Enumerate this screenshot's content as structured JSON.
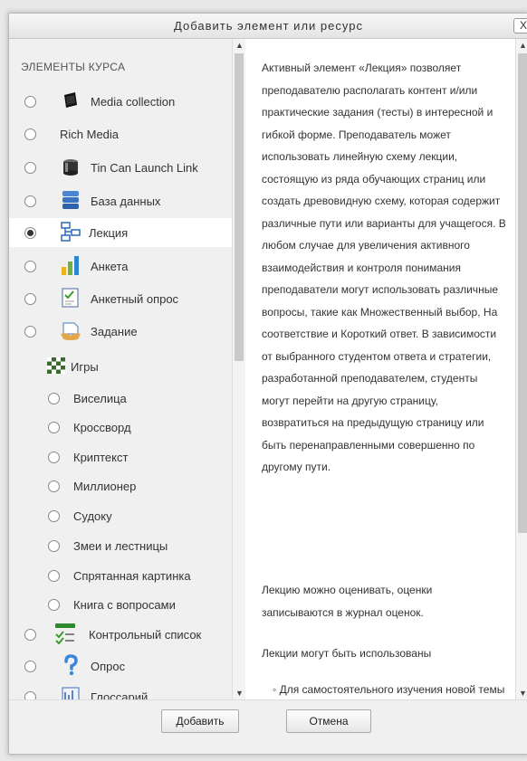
{
  "dialog": {
    "title": "Добавить элемент или ресурс",
    "close_label": "X"
  },
  "left": {
    "section_heading": "ЭЛЕМЕНТЫ КУРСА",
    "items": [
      {
        "label": "Media collection",
        "icon": "media-collection-icon",
        "checked": false
      },
      {
        "label": "Rich Media",
        "icon": "",
        "checked": false
      },
      {
        "label": "Tin Can Launch Link",
        "icon": "tincan-icon",
        "checked": false
      },
      {
        "label": "База данных",
        "icon": "database-icon",
        "checked": false
      },
      {
        "label": "Лекция",
        "icon": "lesson-icon",
        "checked": true
      },
      {
        "label": "Анкета",
        "icon": "questionnaire-icon",
        "checked": false
      },
      {
        "label": "Анкетный опрос",
        "icon": "survey-icon",
        "checked": false
      },
      {
        "label": "Задание",
        "icon": "assignment-icon",
        "checked": false
      }
    ],
    "games_group": {
      "label": "Игры",
      "icon": "games-icon",
      "items": [
        "Виселица",
        "Кроссворд",
        "Криптекст",
        "Миллионер",
        "Судоку",
        "Змеи и лестницы",
        "Спрятанная картинка",
        "Книга с вопросами"
      ]
    },
    "items_after": [
      {
        "label": "Контрольный список",
        "icon": "checklist-icon"
      },
      {
        "label": "Опрос",
        "icon": "choice-icon"
      },
      {
        "label": "Глоссарий",
        "icon": "glossary-icon"
      }
    ]
  },
  "description": {
    "paragraphs": [
      "Активный элемент «Лекция» позволяет преподавателю располагать контент и/или практические задания (тесты) в интересной и гибкой форме. Преподаватель может использовать линейную схему лекции, состоящую из ряда обучающих страниц или создать древовидную схему, которая содержит различные пути или варианты для учащегося. В любом случае для увеличения активного взаимодействия и контроля понимания преподаватели могут использовать различные вопросы, такие как Множественный выбор, На соответствие и Короткий ответ. В зависимости от выбранного студентом ответа и стратегии, разработанной преподавателем, студенты могут перейти на другую страницу, возвратиться на предыдущую страницу или быть перенаправленными совершенно по другому пути.",
      "Лекцию можно оценивать, оценки записываются в журнал оценок.",
      "Лекции могут быть использованы"
    ],
    "bullets": [
      "Для самостоятельного изучения новой темы"
    ]
  },
  "footer": {
    "add_label": "Добавить",
    "cancel_label": "Отмена"
  },
  "colors": {
    "pane_bg": "#f0f0f0",
    "selected_bg": "#ffffff",
    "border": "#b8b8b8"
  }
}
